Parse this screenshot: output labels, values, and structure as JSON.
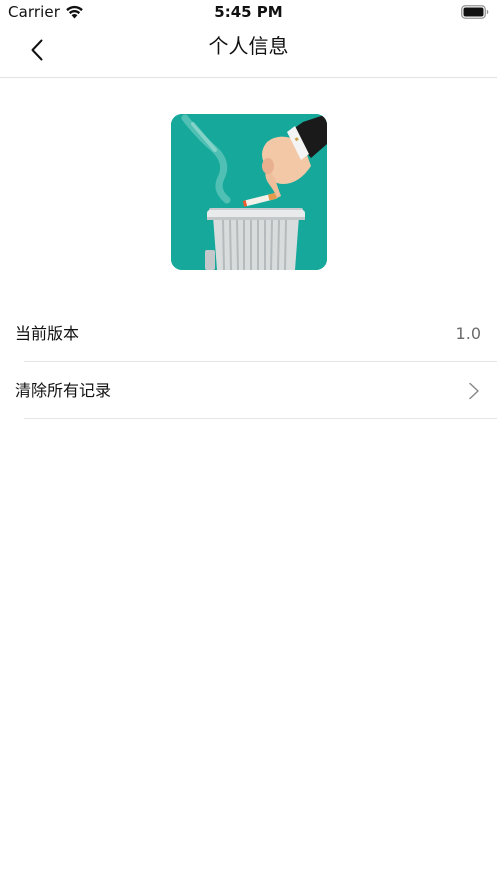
{
  "status_bar": {
    "carrier": "Carrier",
    "time": "5:45 PM",
    "icons": [
      "wifi-icon",
      "battery-icon"
    ]
  },
  "nav": {
    "title": "个人信息",
    "back_icon": "chevron-left-icon"
  },
  "image": {
    "description_icon": "trash-bin-cigarette-illustration",
    "background_color": "#16a99b"
  },
  "settings": [
    {
      "label": "当前版本",
      "value": "1.0"
    },
    {
      "label": "清除所有记录",
      "icon": "chevron-right-icon"
    }
  ]
}
